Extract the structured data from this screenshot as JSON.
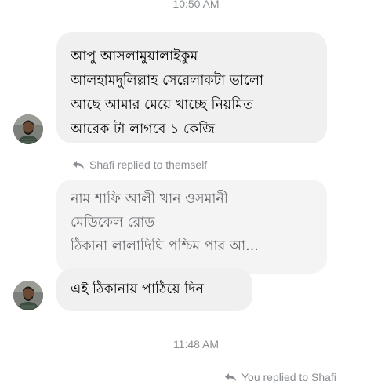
{
  "timestamps": {
    "top": "10:50 AM",
    "middle": "11:48 AM"
  },
  "messages": {
    "first": {
      "lines": [
        "আপু আসলামুয়ালাইকুম",
        "আলহামদুলিল্লাহ সেরেলাকটা ভালো",
        "আছে আমার মেয়ে খাচ্ছে নিয়মিত",
        "আরেক টা লাগবে ১ কেজি"
      ]
    },
    "reply_label": "Shafi replied to themself",
    "quoted": {
      "lines": [
        "নাম শাফি আলী খান ওসমানী",
        "মেডিকেল রোড",
        "ঠিকানা লালাদিঘি পশ্চিম পার আ..."
      ]
    },
    "second": {
      "text": "এই ঠিকানায় পাঠিয়ে দিন"
    },
    "own_reply_label": "You replied to Shafi"
  },
  "icons": {
    "reply": "reply-arrow-icon",
    "avatar": "user-avatar"
  },
  "colors": {
    "bubble": "#f0f0f0",
    "quoted_bubble": "#f4f4f4",
    "meta_text": "#8a8d91"
  }
}
